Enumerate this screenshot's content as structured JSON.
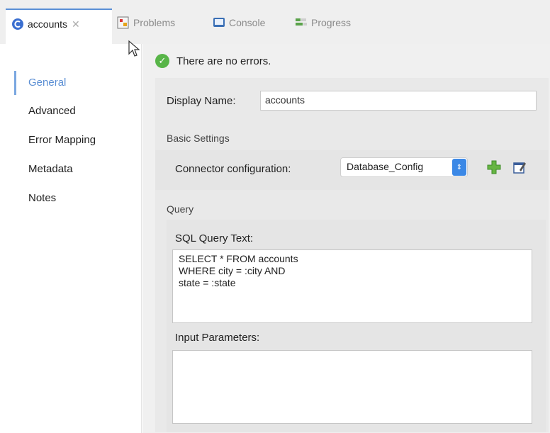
{
  "tabs": {
    "accounts": "accounts",
    "problems": "Problems",
    "console": "Console",
    "progress": "Progress"
  },
  "nav": {
    "general": "General",
    "advanced": "Advanced",
    "error_mapping": "Error Mapping",
    "metadata": "Metadata",
    "notes": "Notes"
  },
  "status_text": "There are no errors.",
  "display_name": {
    "label": "Display Name:",
    "value": "accounts"
  },
  "basic_settings": {
    "heading": "Basic Settings",
    "connector_label": "Connector configuration:",
    "connector_value": "Database_Config"
  },
  "query": {
    "heading": "Query",
    "sql_label": "SQL Query Text:",
    "sql_text": "SELECT * FROM accounts\nWHERE city = :city AND\nstate = :state",
    "params_label": "Input Parameters:",
    "params_text": ""
  },
  "colors": {
    "accent": "#5b8fd4",
    "success": "#58b548",
    "select_arrow": "#3b88e6"
  }
}
